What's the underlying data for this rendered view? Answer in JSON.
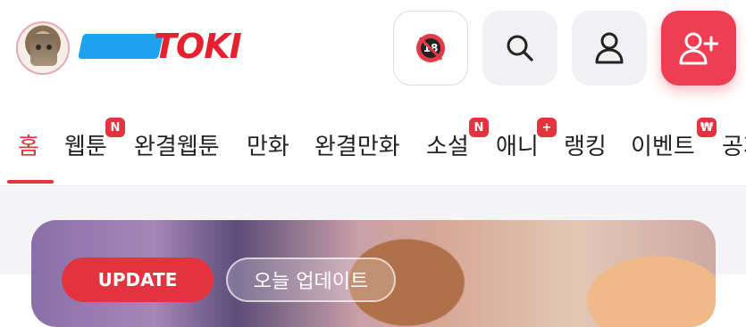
{
  "header": {
    "logo_text": "TOKI",
    "buttons": [
      {
        "name": "adult-filter",
        "icon": "adult-18-icon",
        "label": "18"
      },
      {
        "name": "search",
        "icon": "search-icon"
      },
      {
        "name": "profile",
        "icon": "user-icon"
      },
      {
        "name": "signup",
        "icon": "add-user-icon"
      }
    ]
  },
  "nav": {
    "items": [
      {
        "label": "홈",
        "active": true
      },
      {
        "label": "웹툰",
        "badge": "N"
      },
      {
        "label": "완결웹툰"
      },
      {
        "label": "만화"
      },
      {
        "label": "완결만화"
      },
      {
        "label": "소설",
        "badge": "N"
      },
      {
        "label": "애니",
        "badge": "+"
      },
      {
        "label": "랭킹"
      },
      {
        "label": "이벤트",
        "badge": "₩"
      },
      {
        "label": "공지"
      }
    ]
  },
  "banner": {
    "tag_update": "UPDATE",
    "tag_today": "오늘 업데이트"
  },
  "colors": {
    "accent": "#e2333f",
    "brand_red": "#ee3e52"
  }
}
